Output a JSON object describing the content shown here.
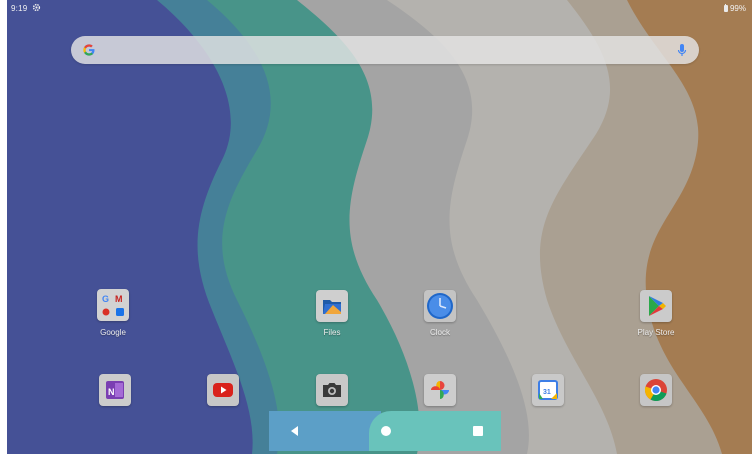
{
  "status_bar": {
    "time": "9:19",
    "battery": "99%",
    "icons": [
      "gear-icon",
      "battery-icon"
    ]
  },
  "search_bar": {
    "logo_icon": "google-g-icon",
    "mic_icon": "microphone-icon"
  },
  "home_apps": [
    {
      "label": "Google",
      "icon": "google-folder-icon"
    },
    {
      "label": "Files",
      "icon": "files-icon"
    },
    {
      "label": "Clock",
      "icon": "clock-icon"
    },
    {
      "label": "Play Store",
      "icon": "play-store-icon"
    }
  ],
  "dock_apps": [
    {
      "icon": "onenote-icon"
    },
    {
      "icon": "youtube-icon"
    },
    {
      "icon": "camera-icon"
    },
    {
      "icon": "photos-icon"
    },
    {
      "icon": "calendar-icon",
      "text": "31"
    },
    {
      "icon": "chrome-icon"
    }
  ],
  "nav_bar": {
    "buttons": [
      "back-icon",
      "home-icon",
      "recents-icon"
    ]
  },
  "colors": {
    "wallpaper_blue": "#4a52b0",
    "wallpaper_teal": "#4fb0a8",
    "wallpaper_beige": "#d9c7ae",
    "wallpaper_orange": "#d2a06a",
    "nav_blue": "#5c9fc7",
    "nav_teal": "#69c3bb"
  }
}
